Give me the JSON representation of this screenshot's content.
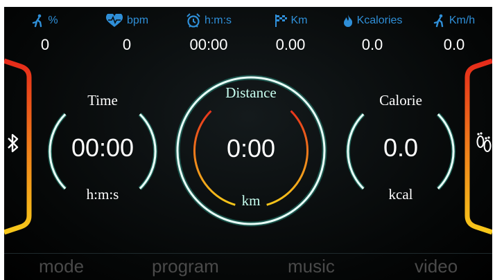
{
  "stats": [
    {
      "icon": "runner-icon",
      "unit": "%",
      "value": "0"
    },
    {
      "icon": "heart-icon",
      "unit": "bpm",
      "value": "0"
    },
    {
      "icon": "alarm-clock-icon",
      "unit": "h:m:s",
      "value": "00:00"
    },
    {
      "icon": "checkered-flag-icon",
      "unit": "Km",
      "value": "0.00"
    },
    {
      "icon": "flame-icon",
      "unit": "Kcalories",
      "value": "0.0"
    },
    {
      "icon": "runner-icon",
      "unit": "Km/h",
      "value": "0.0"
    }
  ],
  "gauges": {
    "time": {
      "label": "Time",
      "value": "00:00",
      "unit": "h:m:s"
    },
    "distance": {
      "label": "Distance",
      "value": "0:00",
      "unit": "km"
    },
    "calorie": {
      "label": "Calorie",
      "value": "0.0",
      "unit": "kcal"
    }
  },
  "nav": {
    "mode": "mode",
    "program": "program",
    "music": "music",
    "video": "video"
  },
  "colors": {
    "accent_blue": "#2f8fd8",
    "ring_white": "#e8fff8",
    "ring_glow": "#3cf0d0",
    "arc_red": "#e8341c",
    "arc_yellow": "#f5c61a",
    "nav_text": "#4a4a4a"
  },
  "side_icons": {
    "left": "bluetooth-icon",
    "right": "footprints-icon"
  }
}
